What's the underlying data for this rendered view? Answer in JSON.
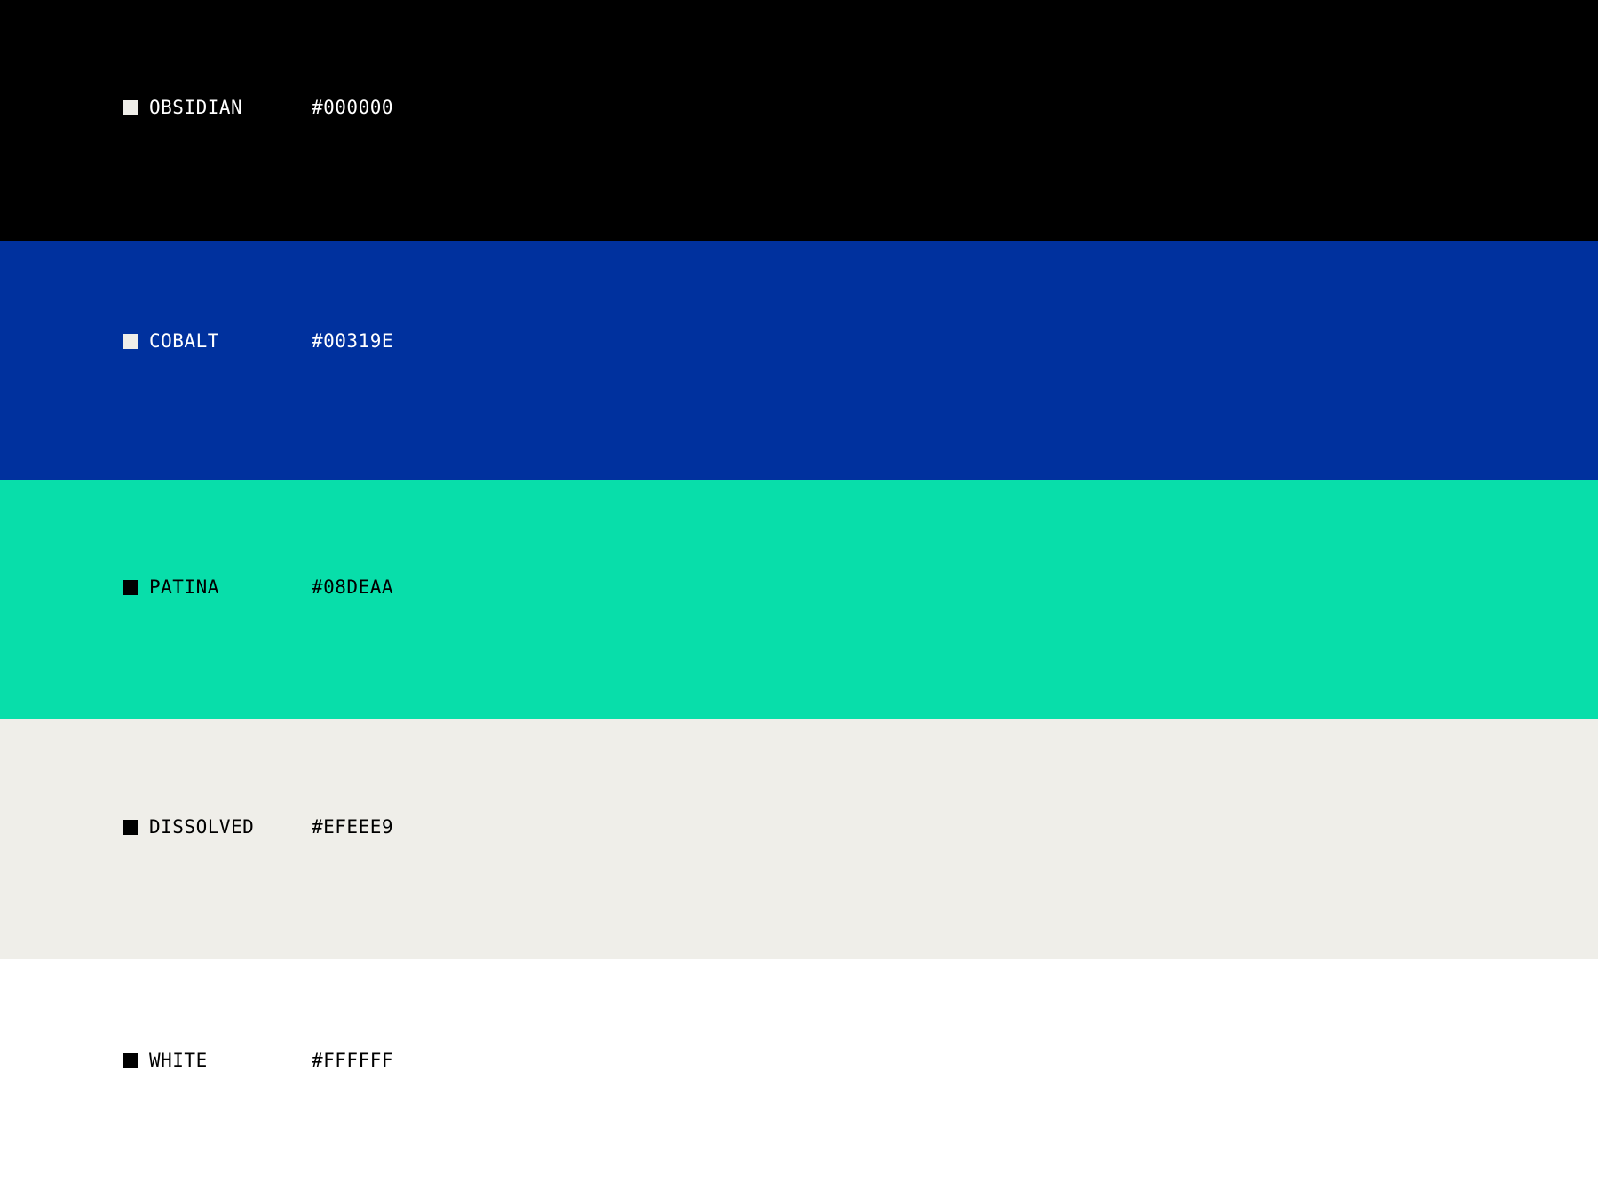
{
  "colors": [
    {
      "name": "OBSIDIAN",
      "hex": "#000000",
      "background": "#000000",
      "text_color": "#FFFFFF",
      "marker_color": "#EFEEE9"
    },
    {
      "name": "COBALT",
      "hex": "#00319E",
      "background": "#00319E",
      "text_color": "#FFFFFF",
      "marker_color": "#EFEEE9"
    },
    {
      "name": "PATINA",
      "hex": "#08DEAA",
      "background": "#08DEAA",
      "text_color": "#000000",
      "marker_color": "#000000"
    },
    {
      "name": "DISSOLVED",
      "hex": "#EFEEE9",
      "background": "#EFEEE9",
      "text_color": "#000000",
      "marker_color": "#000000"
    },
    {
      "name": "WHITE",
      "hex": "#FFFFFF",
      "background": "#FFFFFF",
      "text_color": "#000000",
      "marker_color": "#000000"
    }
  ]
}
